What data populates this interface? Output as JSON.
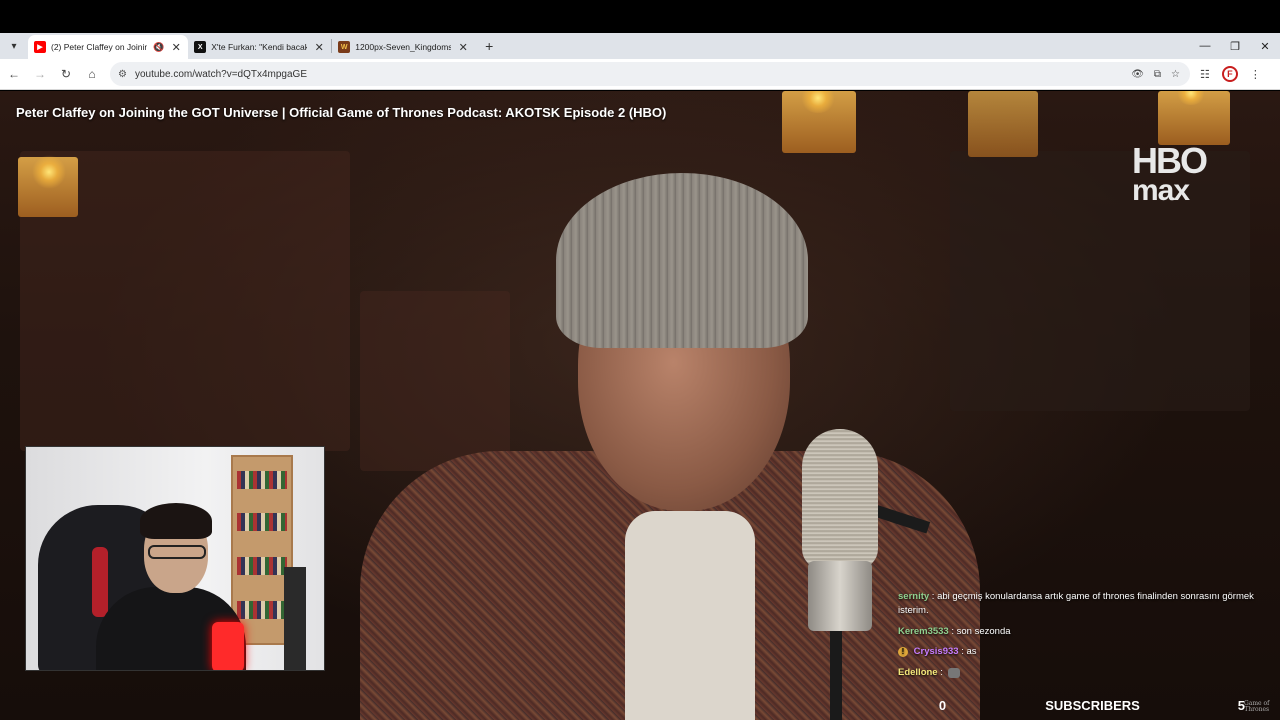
{
  "browser": {
    "tabs": [
      {
        "title": "(2) Peter Claffey on Joining",
        "favicon": "youtube-icon",
        "active": true,
        "muted": true
      },
      {
        "title": "X'te Furkan: \"Kendi bacaklarına",
        "favicon": "x-icon",
        "active": false
      },
      {
        "title": "1200px-Seven_Kingdoms.svg.p",
        "favicon": "wiki-icon",
        "active": false
      }
    ],
    "url": "youtube.com/watch?v=dQTx4mpgaGE"
  },
  "video": {
    "title": "Peter Claffey on Joining the GOT Universe | Official Game of Thrones Podcast: AKOTSK Episode 2 (HBO)",
    "logo_line1": "HBO",
    "logo_line2": "max"
  },
  "chat": [
    {
      "user": "sernity",
      "user_color": "#8fd08f",
      "message": "abi geçmiş konulardansa artık game of thrones finalinden sonrasını görmek isterim."
    },
    {
      "user": "Kerem3533",
      "user_color": "#8fd08f",
      "message": "son sezonda"
    },
    {
      "user": "Crysis933",
      "user_color": "#c77dff",
      "message": "as",
      "badge": true
    },
    {
      "user": "Edellone",
      "user_color": "#f2e77a",
      "message": "",
      "emote": true
    }
  ],
  "subscribers": {
    "left_count": "0",
    "label": "SUBSCRIBERS",
    "right_count": "5"
  }
}
